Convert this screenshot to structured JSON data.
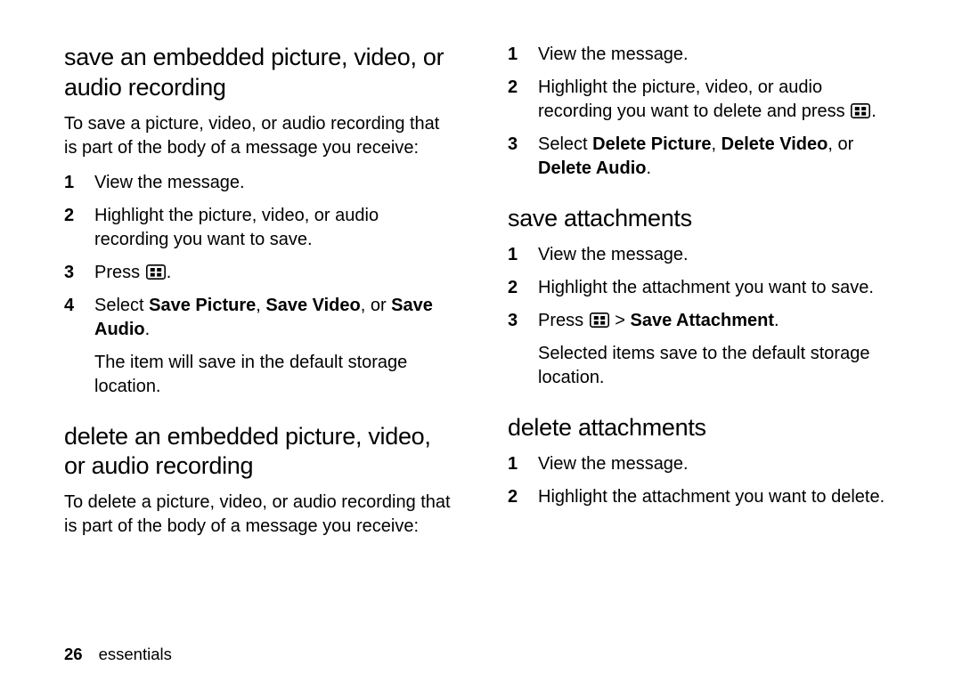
{
  "page_number": "26",
  "section_label": "essentials",
  "left": {
    "h_save": "save an embedded picture, video, or audio recording",
    "intro_save": "To save a picture, video, or audio recording that is part of the body of a message you receive:",
    "save_steps": {
      "s1": "View the message.",
      "s2": "Highlight the picture, video, or audio recording you want to save.",
      "s3_pre": "Press ",
      "s3_post": ".",
      "s4_pre": "Select ",
      "s4_b1": "Save Picture",
      "s4_sep1": ", ",
      "s4_b2": "Save Video",
      "s4_sep2": ", or ",
      "s4_b3": "Save Audio",
      "s4_post": ".",
      "s4_sub": "The item will save in the default storage location."
    },
    "h_del": "delete an embedded picture, video, or audio recording",
    "intro_del": "To delete a picture, video, or audio recording that is part of the body of a message you receive:"
  },
  "right": {
    "del_steps": {
      "s1": "View the message.",
      "s2_pre": "Highlight the picture, video, or audio recording you want to delete and press ",
      "s2_post": ".",
      "s3_pre": "Select ",
      "s3_b1": "Delete Picture",
      "s3_sep1": ", ",
      "s3_b2": "Delete Video",
      "s3_sep2": ", or ",
      "s3_b3": "Delete Audio",
      "s3_post": "."
    },
    "h_save_att": "save attachments",
    "save_att_steps": {
      "s1": "View the message.",
      "s2": "Highlight the attachment you want to save.",
      "s3_pre": "Press ",
      "s3_mid": " > ",
      "s3_b": "Save Attachment",
      "s3_post": ".",
      "s3_sub": "Selected items save to the default storage location."
    },
    "h_del_att": "delete attachments",
    "del_att_steps": {
      "s1": "View the message.",
      "s2": "Highlight the attachment you want to delete."
    }
  },
  "nums": {
    "n1": "1",
    "n2": "2",
    "n3": "3",
    "n4": "4"
  }
}
